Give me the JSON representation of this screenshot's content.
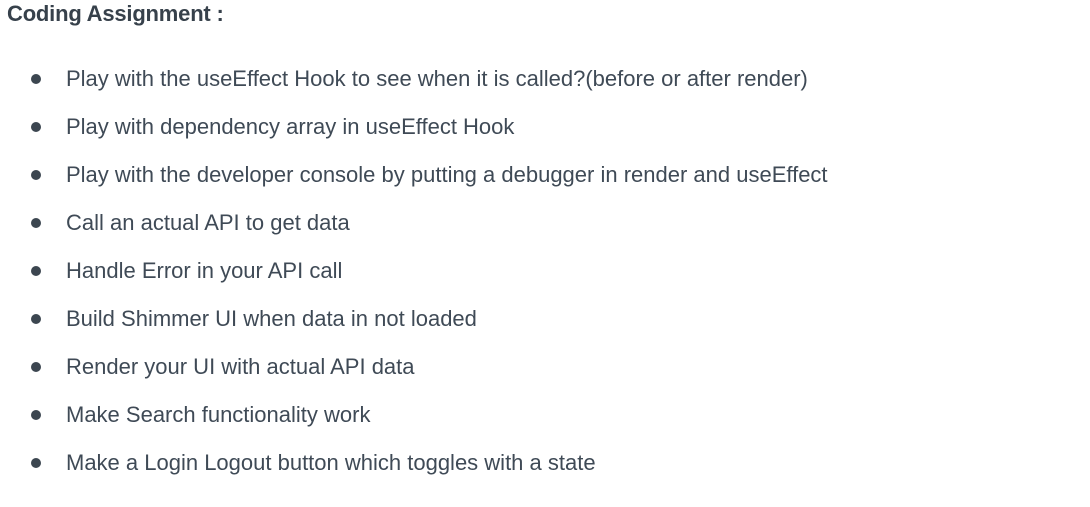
{
  "heading": "Coding Assignment :",
  "tasks": [
    {
      "text": "Play with the useEffect Hook to see when it is called?(before or after render)"
    },
    {
      "text": "Play with dependency array in useEffect Hook"
    },
    {
      "text": "Play with the developer console by putting a debugger in render and useEffect"
    },
    {
      "text": "Call an actual API to get data"
    },
    {
      "text": "Handle Error in your API call"
    },
    {
      "text": "Build Shimmer UI when data in not loaded"
    },
    {
      "text": "Render your UI with actual API data"
    },
    {
      "text": "Make Search functionality work"
    },
    {
      "text": "Make a Login Logout button which toggles with a state"
    }
  ]
}
